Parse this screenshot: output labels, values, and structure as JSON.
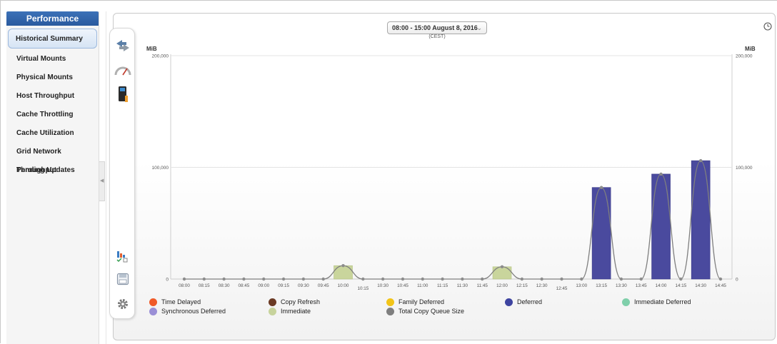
{
  "sidebar": {
    "title": "Performance",
    "items": [
      {
        "label": "Historical Summary"
      },
      {
        "label": "Virtual Mounts"
      },
      {
        "label": "Physical Mounts"
      },
      {
        "label": "Host Throughput"
      },
      {
        "label": "Cache Throttling"
      },
      {
        "label": "Cache Utilization"
      },
      {
        "label": "Grid Network Throughput"
      },
      {
        "label": "Pending Updates"
      }
    ],
    "active_index": 0
  },
  "toolbar": {
    "icons": [
      "arrows-icon",
      "gauge-icon",
      "device-icon",
      "bar-chart-checklist-icon",
      "save-icon",
      "gear-icon"
    ]
  },
  "header": {
    "time_range": "08:00 - 15:00 August 8, 2016",
    "timezone": "(CEST)"
  },
  "chart_data": {
    "type": "bar",
    "left_axis_unit": "MiB",
    "right_axis_unit": "MiB",
    "ylim": [
      0,
      200000
    ],
    "y_ticks": [
      "0",
      "100,000",
      "200,000"
    ],
    "y_tick_values": [
      0,
      100000,
      200000
    ],
    "categories": [
      "08:00",
      "08:15",
      "08:30",
      "08:45",
      "09:00",
      "09:15",
      "09:30",
      "09:45",
      "10:00",
      "10:15",
      "10:30",
      "10:45",
      "11:00",
      "11:15",
      "11:30",
      "11:45",
      "12:00",
      "12:15",
      "12:30",
      "12:45",
      "13:00",
      "13:15",
      "13:30",
      "13:45",
      "14:00",
      "14:15",
      "14:30",
      "14:45"
    ],
    "series": [
      {
        "name": "Immediate",
        "color": "#c9d59c",
        "values": [
          0,
          0,
          0,
          0,
          0,
          0,
          0,
          0,
          12000,
          0,
          0,
          0,
          0,
          0,
          0,
          0,
          11000,
          0,
          0,
          0,
          0,
          0,
          0,
          0,
          0,
          0,
          0,
          0
        ]
      },
      {
        "name": "Deferred",
        "color": "#4a4a9e",
        "values": [
          0,
          0,
          0,
          0,
          0,
          0,
          0,
          0,
          0,
          0,
          0,
          0,
          0,
          0,
          0,
          0,
          0,
          0,
          0,
          0,
          0,
          82000,
          0,
          0,
          94000,
          0,
          106000,
          0
        ]
      },
      {
        "name": "Total Copy Queue Size",
        "color": "#8c8c8c",
        "values": [
          0,
          0,
          0,
          0,
          0,
          0,
          0,
          0,
          12000,
          0,
          0,
          0,
          0,
          0,
          0,
          0,
          11000,
          0,
          0,
          0,
          0,
          82000,
          0,
          0,
          94000,
          0,
          106000,
          0
        ]
      }
    ],
    "grid": true,
    "legend": [
      {
        "name": "Time Delayed",
        "color": "#f05a28"
      },
      {
        "name": "Copy Refresh",
        "color": "#6b3a24"
      },
      {
        "name": "Family Deferred",
        "color": "#f2c418"
      },
      {
        "name": "Deferred",
        "color": "#3e44a0"
      },
      {
        "name": "Immediate Deferred",
        "color": "#7fcfaa"
      },
      {
        "name": "Synchronous Deferred",
        "color": "#9a8fd6"
      },
      {
        "name": "Immediate",
        "color": "#c7d39c"
      },
      {
        "name": "Total Copy Queue Size",
        "color": "#7f7f7f"
      }
    ],
    "legend_position": "bottom"
  }
}
